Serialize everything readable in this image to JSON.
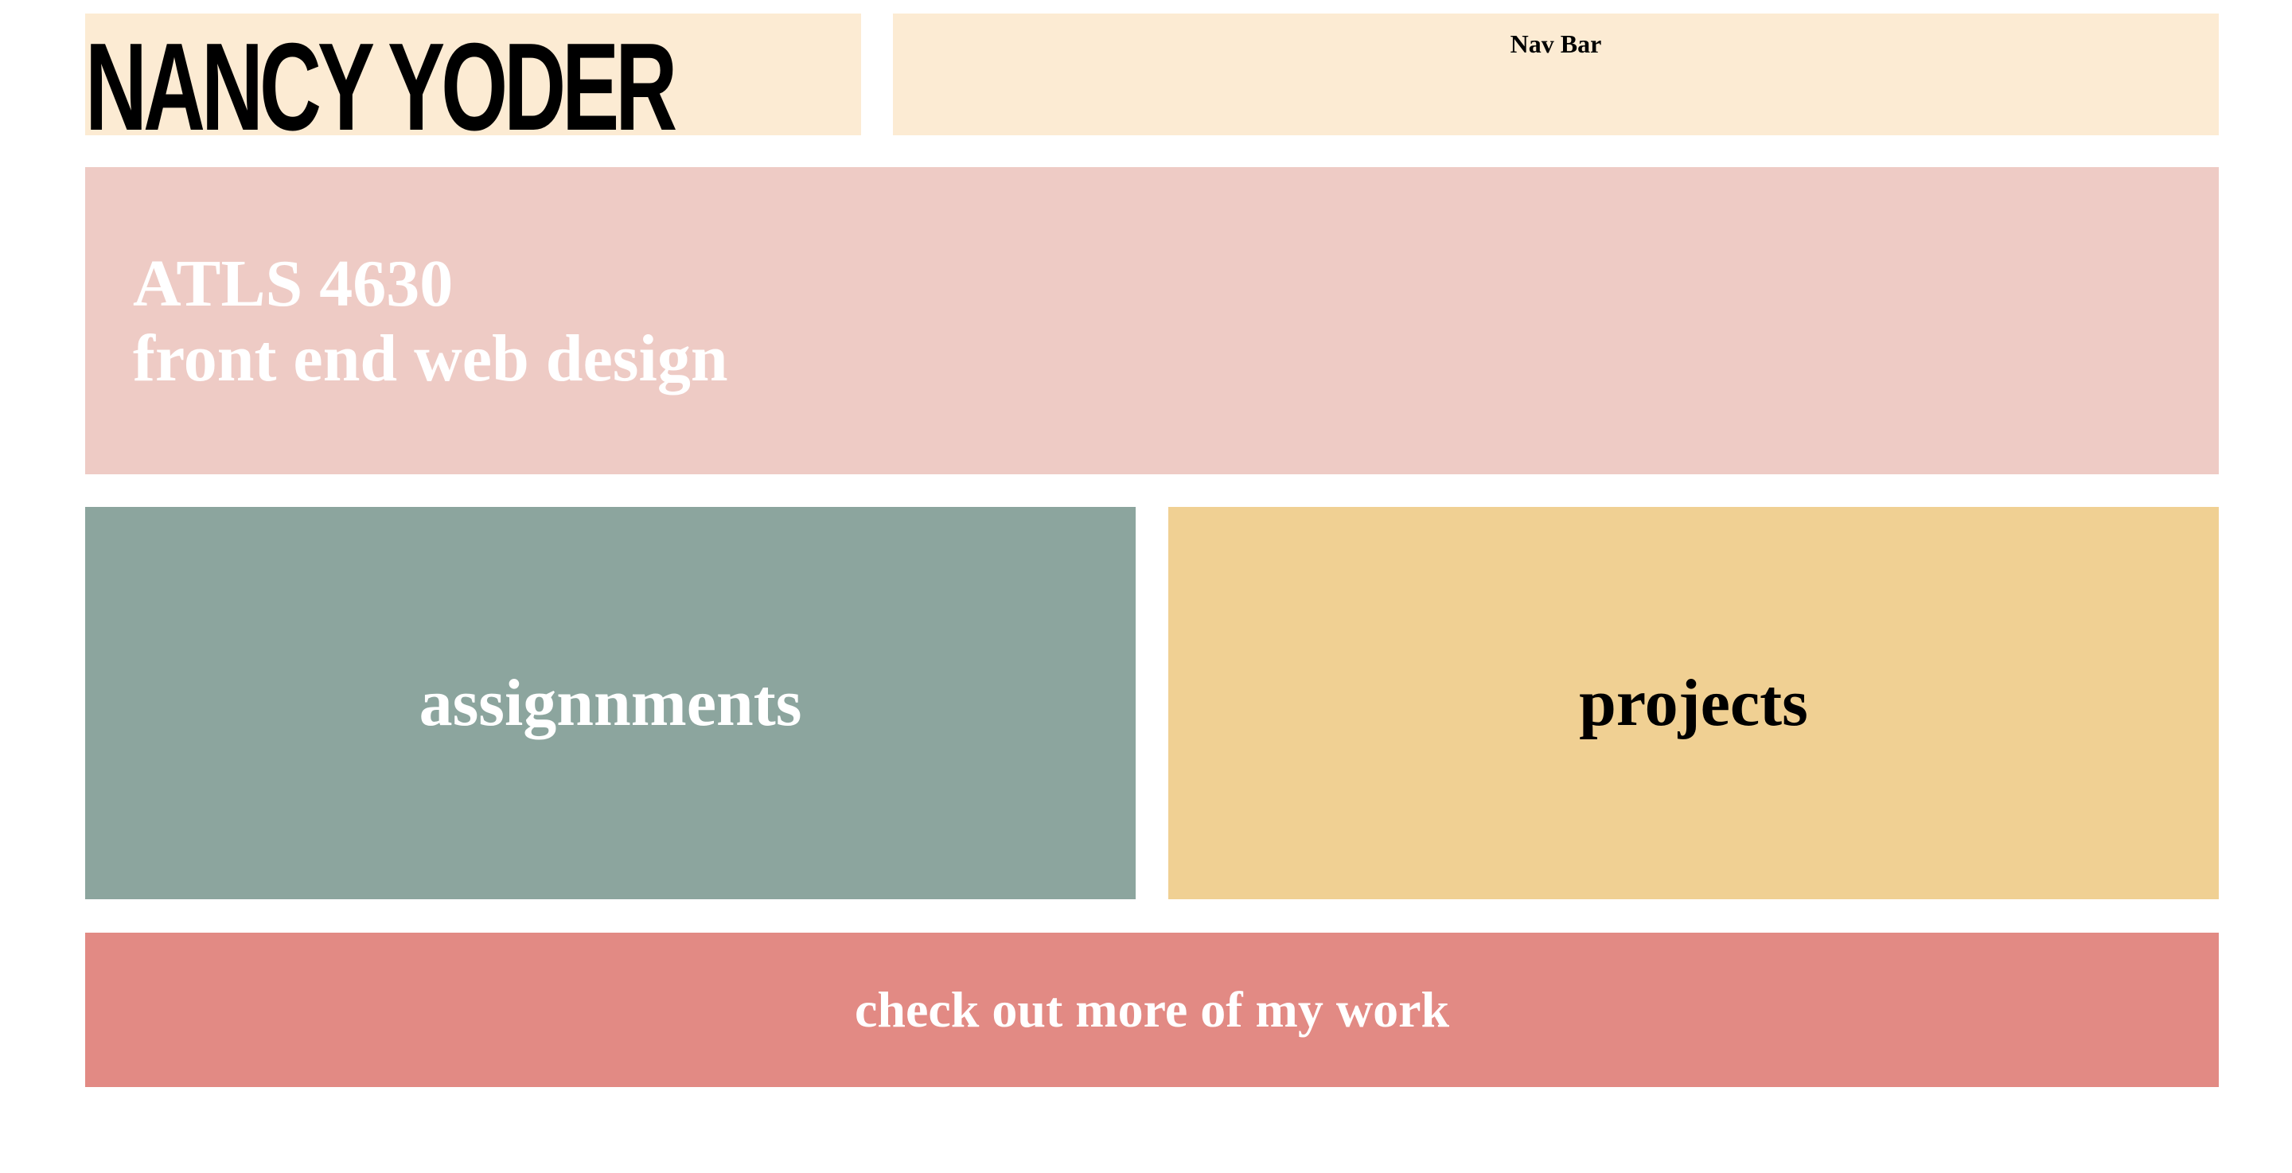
{
  "header": {
    "name": "NANCY YODER",
    "nav_label": "Nav Bar"
  },
  "hero": {
    "line1": "ATLS 4630",
    "line2": "front end web design"
  },
  "cards": [
    {
      "label": "assignnments"
    },
    {
      "label": "projects"
    }
  ],
  "footer": {
    "label": "check out more of my work"
  },
  "colors": {
    "header": "#fcebd3",
    "hero": "#eecbc5",
    "assignments": "#8ca59e",
    "projects": "#f0d093",
    "footer": "#e28a84"
  }
}
